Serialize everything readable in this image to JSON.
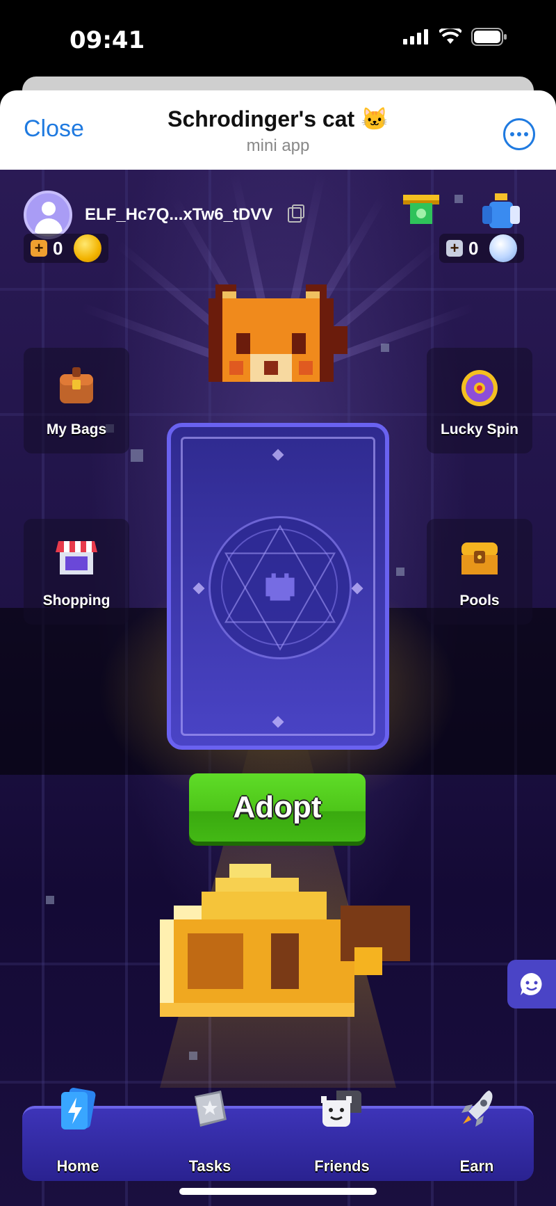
{
  "status": {
    "time": "09:41"
  },
  "header": {
    "close": "Close",
    "title": "Schrodinger's cat 🐱",
    "subtitle": "mini app"
  },
  "user": {
    "name": "ELF_Hc7Q...xTw6_tDVV"
  },
  "counters": {
    "gold": "0",
    "diamond": "0"
  },
  "menu": {
    "my_bags": "My Bags",
    "lucky_spin": "Lucky Spin",
    "shopping": "Shopping",
    "pools": "Pools"
  },
  "adopt": "Adopt",
  "nav": [
    {
      "label": "Home",
      "icon": "cards-lightning-icon"
    },
    {
      "label": "Tasks",
      "icon": "book-star-icon"
    },
    {
      "label": "Friends",
      "icon": "ghost-faces-icon"
    },
    {
      "label": "Earn",
      "icon": "rocket-icon"
    }
  ],
  "colors": {
    "accent": "#1f7ae0",
    "adopt_green": "#4ec619",
    "nav_blue": "#3d34b8",
    "card_border": "#6a62f0"
  }
}
